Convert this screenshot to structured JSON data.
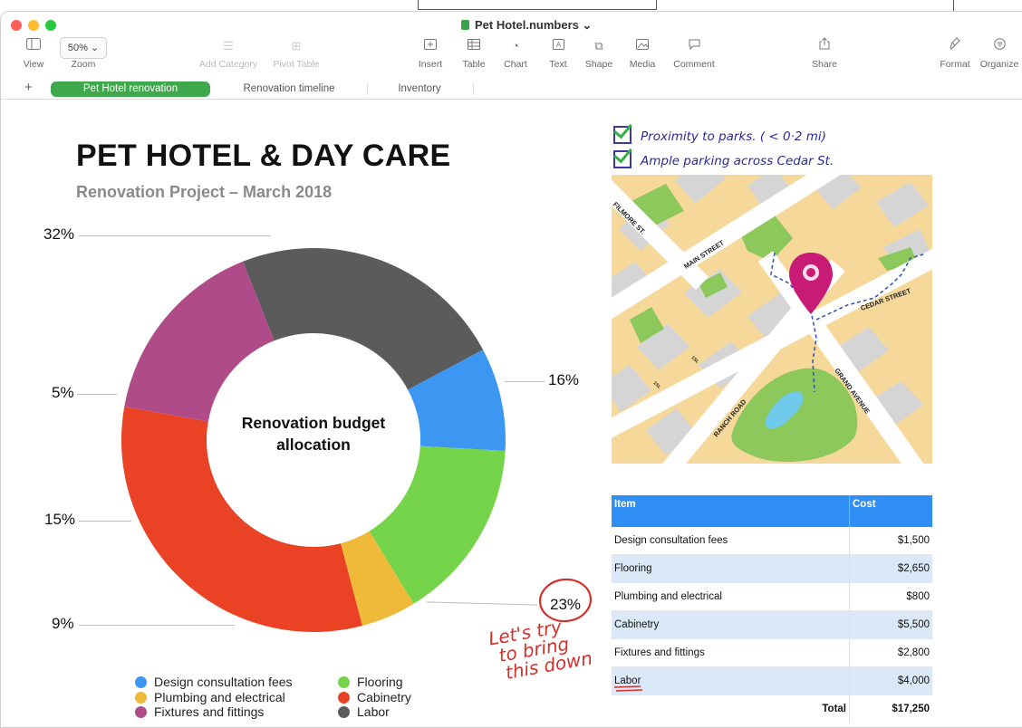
{
  "window": {
    "title": "Pet Hotel.numbers",
    "title_chevron": "⌄",
    "traffic_colors": [
      "#fe5f57",
      "#febc2e",
      "#28c840"
    ]
  },
  "toolbar": {
    "view": "View",
    "zoom_value": "50%",
    "zoom": "Zoom",
    "add_category": "Add Category",
    "pivot_table": "Pivot Table",
    "insert": "Insert",
    "table": "Table",
    "chart": "Chart",
    "text": "Text",
    "shape": "Shape",
    "media": "Media",
    "comment": "Comment",
    "share": "Share",
    "format": "Format",
    "organize": "Organize"
  },
  "tabs": {
    "add": "+",
    "items": [
      "Pet Hotel renovation",
      "Renovation timeline",
      "Inventory"
    ],
    "active_color": "#3fa84d"
  },
  "sheet": {
    "title": "PET HOTEL & DAY CARE",
    "subtitle": "Renovation Project – March 2018"
  },
  "chart_data": {
    "type": "pie",
    "title": "Renovation budget allocation",
    "title_lines": [
      "Renovation budget",
      "allocation"
    ],
    "categories": [
      "Cabinetry",
      "Fixtures and fittings",
      "Labor",
      "Design consultation fees",
      "Flooring",
      "Plumbing and electrical"
    ],
    "values": [
      5500,
      2800,
      4000,
      1500,
      2650,
      800
    ],
    "labels": [
      "32%",
      "16%",
      "23%",
      "9%",
      "15%",
      "5%"
    ],
    "colors": [
      "#ea4225",
      "#b04b8a",
      "#5b5b5b",
      "#3b97f1",
      "#76d44b",
      "#efb93a"
    ],
    "legend": [
      {
        "label": "Design consultation fees",
        "color": "#3b97f1"
      },
      {
        "label": "Flooring",
        "color": "#76d44b"
      },
      {
        "label": "Plumbing and electrical",
        "color": "#efb93a"
      },
      {
        "label": "Cabinetry",
        "color": "#ea4225"
      },
      {
        "label": "Fixtures and fittings",
        "color": "#b04b8a"
      },
      {
        "label": "Labor",
        "color": "#5b5b5b"
      }
    ],
    "legend_position": "bottom"
  },
  "annotations": {
    "check1": "Proximity to parks. ( < 0·2 mi)",
    "check2": "Ample parking across Cedar St.",
    "note_lines": [
      "Let's try",
      "to bring",
      "this down"
    ],
    "circled_value": "23%"
  },
  "map": {
    "streets": [
      "FILMORE ST.",
      "MAIN STREET",
      "CEDAR STREET",
      "GRAND AVENUE",
      "RANCH ROAD"
    ],
    "small_labels": [
      "1St.",
      "1St."
    ]
  },
  "table": {
    "headers": [
      "Item",
      "Cost"
    ],
    "rows": [
      [
        "Design consultation fees",
        "$1,500"
      ],
      [
        "Flooring",
        "$2,650"
      ],
      [
        "Plumbing and electrical",
        "$800"
      ],
      [
        "Cabinetry",
        "$5,500"
      ],
      [
        "Fixtures and fittings",
        "$2,800"
      ],
      [
        "Labor",
        "$4,000"
      ]
    ],
    "total_label": "Total",
    "total_value": "$17,250"
  }
}
